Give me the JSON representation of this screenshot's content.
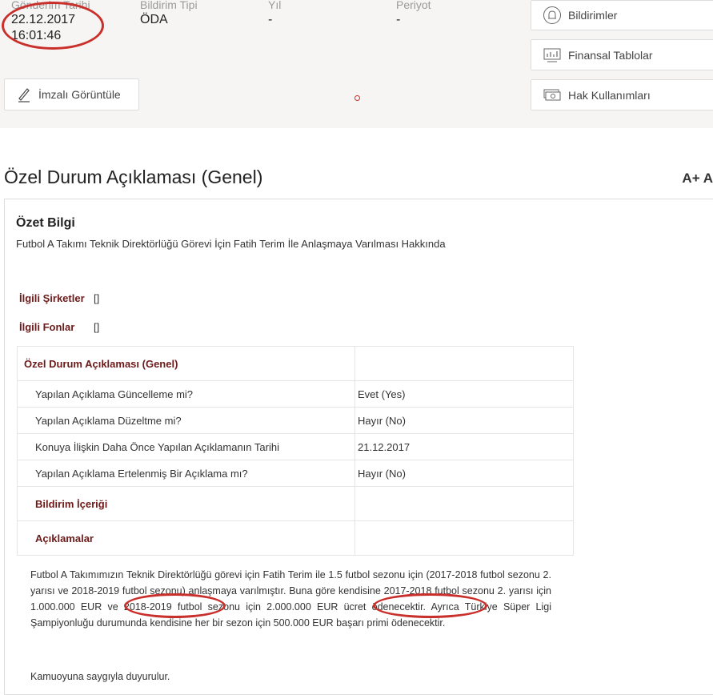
{
  "header": {
    "send_date_label": "Gönderim Tarihi",
    "send_date": "22.12.2017",
    "send_time": "16:01:46",
    "type_label": "Bildirim Tipi",
    "type_value": "ÖDA",
    "year_label": "Yıl",
    "year_value": "-",
    "period_label": "Periyot",
    "period_value": "-",
    "signed_view_label": "İmzalı Görüntüle"
  },
  "side_buttons": {
    "notifications": "Bildirimler",
    "financial_tables": "Finansal Tablolar",
    "rights": "Hak Kullanımları"
  },
  "page": {
    "title": "Özel Durum Açıklaması (Genel)",
    "font_toggle": "A+ A"
  },
  "summary": {
    "title": "Özet Bilgi",
    "text": "Futbol A Takımı Teknik Direktörlüğü Görevi İçin Fatih Terim İle Anlaşmaya Varılması Hakkında"
  },
  "related": {
    "companies_label": "İlgili Şirketler",
    "companies_value": "[]",
    "funds_label": "İlgili Fonlar",
    "funds_value": "[]"
  },
  "details": {
    "heading": "Özel Durum Açıklaması (Genel)",
    "rows": [
      {
        "label": "Yapılan Açıklama Güncelleme mi?",
        "value": "Evet (Yes)"
      },
      {
        "label": "Yapılan Açıklama Düzeltme mi?",
        "value": "Hayır (No)"
      },
      {
        "label": "Konuya İlişkin Daha Önce Yapılan Açıklamanın Tarihi",
        "value": "21.12.2017"
      },
      {
        "label": "Yapılan Açıklama Ertelenmiş Bir Açıklama mı?",
        "value": "Hayır (No)"
      }
    ],
    "content_label": "Bildirim İçeriği",
    "explanations_label": "Açıklamalar"
  },
  "body": {
    "paragraph": "Futbol A Takımımızın Teknik Direktörlüğü görevi için Fatih Terim ile 1.5 futbol sezonu için (2017-2018 futbol sezonu 2. yarısı ve 2018-2019 futbol sezonu) anlaşmaya varılmıştır. Buna göre kendisine 2017-2018 futbol sezonu 2. yarısı için 1.000.000 EUR ve 2018-2019 futbol sezonu için 2.000.000 EUR ücret ödenecektir. Ayrıca Türkiye Süper Ligi Şampiyonluğu durumunda kendisine her bir sezon için 500.000 EUR başarı primi ödenecektir.",
    "closing": "Kamuoyuna saygıyla duyurulur."
  },
  "colors": {
    "accent": "#6d1a1a",
    "annotation_red": "#c9302c"
  }
}
